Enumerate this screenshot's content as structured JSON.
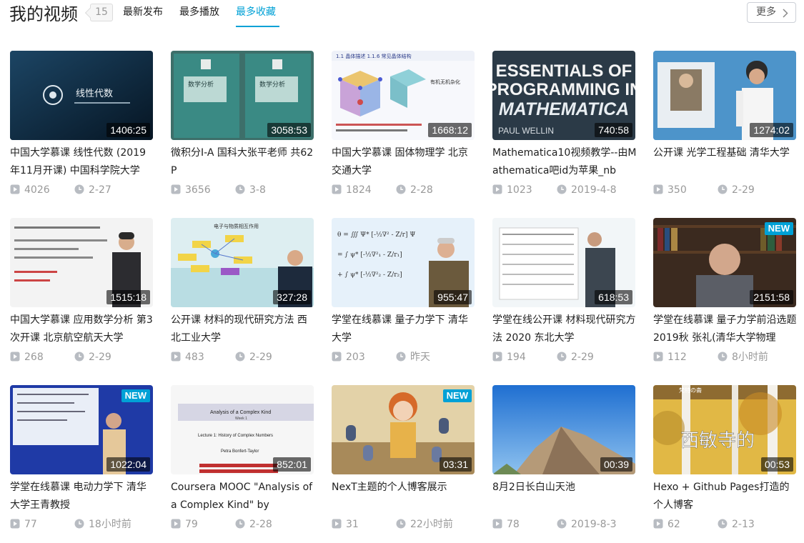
{
  "header": {
    "title": "我的视频",
    "count": "15",
    "tabs": [
      "最新发布",
      "最多播放",
      "最多收藏"
    ],
    "more_label": "更多"
  },
  "colors": {
    "accent": "#00a1d6",
    "text": "#212121",
    "muted": "#999999"
  },
  "icons": {
    "play": "play-icon",
    "date": "clock-icon",
    "more": "chevron-right-icon"
  },
  "videos": [
    {
      "title": "中国大学慕课 线性代数 (2019年11月开课) 中国科学院大学",
      "duration": "1406:25",
      "plays": "4026",
      "date": "2-27",
      "is_new": false,
      "thumb_text": "线性代数"
    },
    {
      "title": "微积分I-A 国科大张平老师 共62 P",
      "duration": "3058:53",
      "plays": "3656",
      "date": "3-8",
      "is_new": false,
      "thumb_text": "数学分析"
    },
    {
      "title": "中国大学慕课 固体物理学 北京交通大学",
      "duration": "1668:12",
      "plays": "1824",
      "date": "2-28",
      "is_new": false,
      "thumb_text": "1.1 晶体描述"
    },
    {
      "title": "Mathematica10视频教学--由Mathematica吧id为苹果_nb",
      "duration": "740:58",
      "plays": "1023",
      "date": "2019-4-8",
      "is_new": false,
      "thumb_text": "ESSENTIALS OF PROGRAMMING IN MATHEMATICA"
    },
    {
      "title": "公开课 光学工程基础 清华大学",
      "duration": "1274:02",
      "plays": "350",
      "date": "2-29",
      "is_new": false,
      "thumb_text": ""
    },
    {
      "title": "中国大学慕课 应用数学分析 第3次开课 北京航空航天大学",
      "duration": "1515:18",
      "plays": "268",
      "date": "2-29",
      "is_new": false,
      "thumb_text": ""
    },
    {
      "title": "公开课 材料的现代研究方法 西北工业大学",
      "duration": "327:28",
      "plays": "483",
      "date": "2-29",
      "is_new": false,
      "thumb_text": ""
    },
    {
      "title": "学堂在线慕课 量子力学下 清华大学",
      "duration": "955:47",
      "plays": "203",
      "date": "昨天",
      "is_new": false,
      "thumb_text": ""
    },
    {
      "title": "学堂在线公开课 材料现代研究方法 2020 东北大学",
      "duration": "618:53",
      "plays": "194",
      "date": "2-29",
      "is_new": false,
      "thumb_text": ""
    },
    {
      "title": "学堂在线慕课 量子力学前沿选题 2019秋 张礼(清华大学物理",
      "duration": "2151:58",
      "plays": "112",
      "date": "8小时前",
      "is_new": true,
      "thumb_text": ""
    },
    {
      "title": "学堂在线慕课 电动力学下 清华大学王青教授",
      "duration": "1022:04",
      "plays": "77",
      "date": "18小时前",
      "is_new": true,
      "thumb_text": ""
    },
    {
      "title": "Coursera MOOC \"Analysis of a Complex Kind\" by",
      "duration": "852:01",
      "plays": "79",
      "date": "2-28",
      "is_new": false,
      "thumb_text": "Analysis of a Complex Kind"
    },
    {
      "title": "NexT主题的个人博客展示",
      "duration": "03:31",
      "plays": "31",
      "date": "22小时前",
      "is_new": true,
      "thumb_text": ""
    },
    {
      "title": "8月2日长白山天池",
      "duration": "00:39",
      "plays": "78",
      "date": "2019-8-3",
      "is_new": false,
      "thumb_text": ""
    },
    {
      "title": "Hexo + Github Pages打造的个人博客",
      "duration": "00:53",
      "plays": "62",
      "date": "2-13",
      "is_new": false,
      "thumb_text": "西敏寺的"
    }
  ]
}
